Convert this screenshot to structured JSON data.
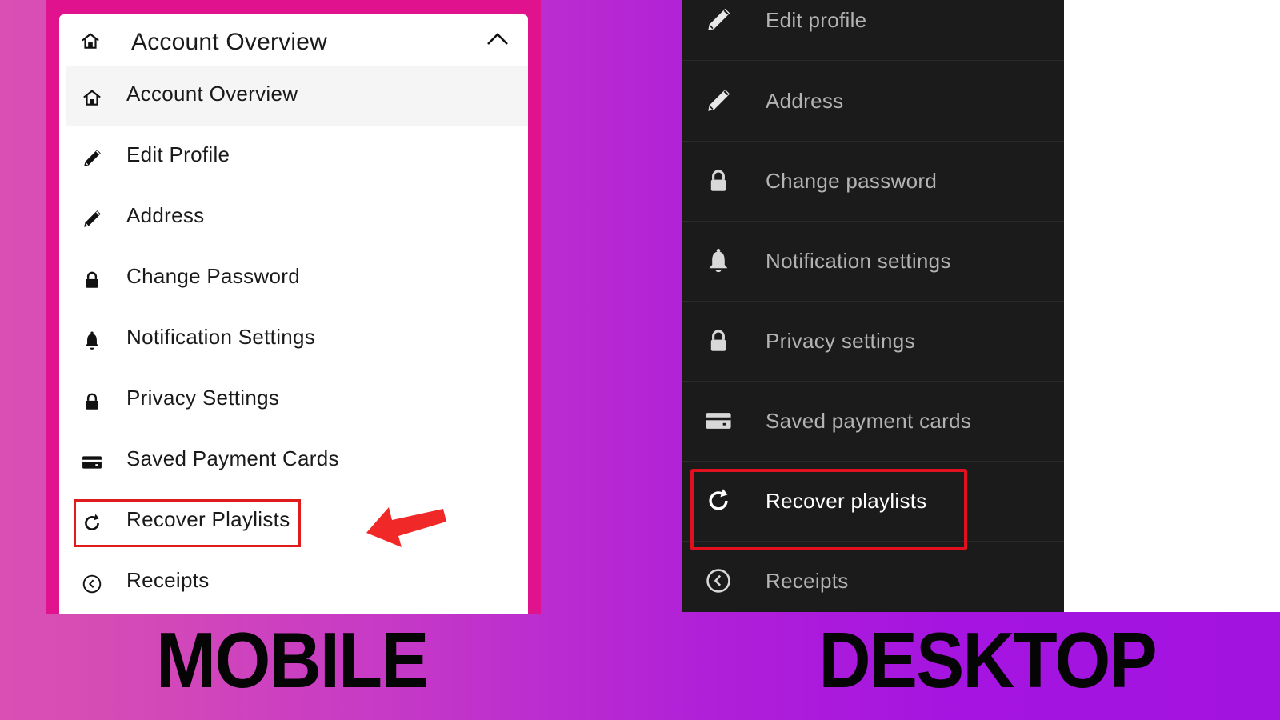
{
  "mobile": {
    "header": {
      "title": "Account Overview",
      "icon": "home-icon",
      "toggle_icon": "chevron-up-icon"
    },
    "items": [
      {
        "label": "Account Overview",
        "icon": "home-icon",
        "active": true
      },
      {
        "label": "Edit Profile",
        "icon": "pencil-icon"
      },
      {
        "label": "Address",
        "icon": "pencil-icon"
      },
      {
        "label": "Change Password",
        "icon": "lock-icon"
      },
      {
        "label": "Notification Settings",
        "icon": "bell-icon"
      },
      {
        "label": "Privacy Settings",
        "icon": "lock-icon"
      },
      {
        "label": "Saved Payment Cards",
        "icon": "credit-card-icon"
      },
      {
        "label": "Recover Playlists",
        "icon": "refresh-icon",
        "highlighted": true
      },
      {
        "label": "Receipts",
        "icon": "clock-back-icon"
      }
    ],
    "caption": "MOBILE"
  },
  "desktop": {
    "items": [
      {
        "label": "Edit profile",
        "icon": "pencil-icon"
      },
      {
        "label": "Address",
        "icon": "pencil-icon"
      },
      {
        "label": "Change password",
        "icon": "lock-icon"
      },
      {
        "label": "Notification settings",
        "icon": "bell-icon"
      },
      {
        "label": "Privacy settings",
        "icon": "lock-icon"
      },
      {
        "label": "Saved payment cards",
        "icon": "credit-card-icon"
      },
      {
        "label": "Recover playlists",
        "icon": "refresh-icon",
        "highlighted": true
      },
      {
        "label": "Receipts",
        "icon": "clock-back-icon"
      }
    ],
    "caption": "DESKTOP"
  },
  "colors": {
    "mobile_frame": "#e1128e",
    "desktop_panel": "#1b1b1b",
    "highlight": "#e01b1b",
    "background_left": "#d94fb3",
    "background_right": "#a313e0"
  }
}
